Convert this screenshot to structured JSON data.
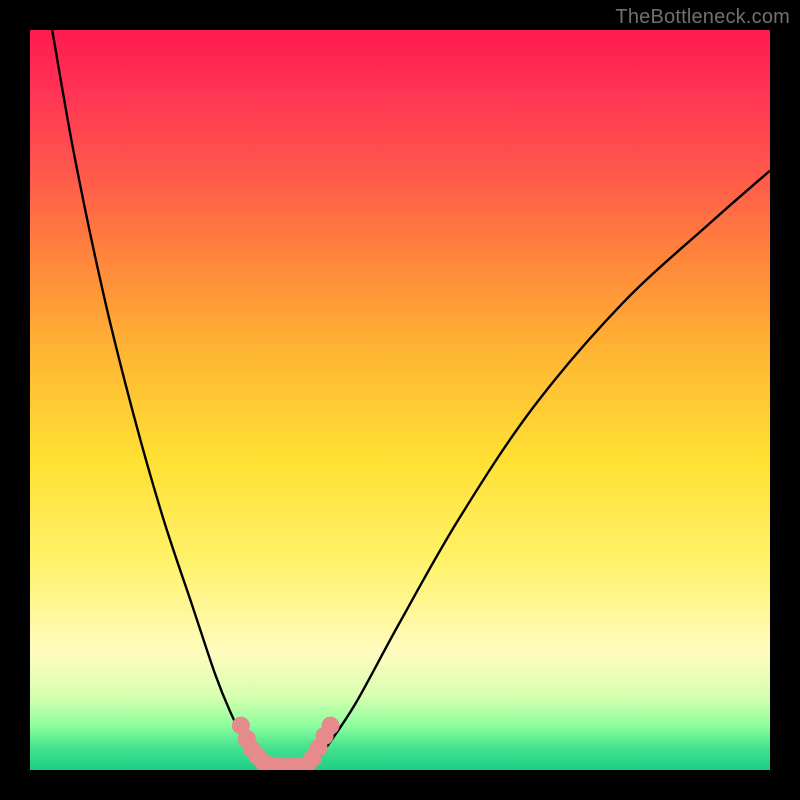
{
  "watermark": "TheBottleneck.com",
  "chart_data": {
    "type": "line",
    "title": "",
    "xlabel": "",
    "ylabel": "",
    "xlim": [
      0,
      100
    ],
    "ylim": [
      0,
      100
    ],
    "gradient_stops": [
      {
        "pct": 0,
        "color": "#ff1a4d"
      },
      {
        "pct": 8,
        "color": "#ff3355"
      },
      {
        "pct": 20,
        "color": "#ff5b4a"
      },
      {
        "pct": 32,
        "color": "#ff8a3a"
      },
      {
        "pct": 44,
        "color": "#ffb733"
      },
      {
        "pct": 58,
        "color": "#ffe033"
      },
      {
        "pct": 72,
        "color": "#fff26b"
      },
      {
        "pct": 84,
        "color": "#fffcbf"
      },
      {
        "pct": 90,
        "color": "#d8ffb0"
      },
      {
        "pct": 94,
        "color": "#8cff9e"
      },
      {
        "pct": 97,
        "color": "#44e28f"
      },
      {
        "pct": 100,
        "color": "#1ccf86"
      }
    ],
    "series": [
      {
        "name": "bottleneck-curve",
        "x": [
          3,
          6,
          10,
          14,
          18,
          22,
          25,
          27,
          29,
          30.5,
          32,
          34,
          36,
          38.5,
          40,
          44,
          50,
          58,
          68,
          80,
          92,
          100
        ],
        "y": [
          100,
          83,
          64,
          48,
          34,
          22,
          13,
          8,
          4,
          2,
          1,
          0.5,
          0.5,
          1,
          3,
          9,
          20,
          34,
          49,
          63,
          74,
          81
        ]
      }
    ],
    "markers": {
      "name": "highlight-region",
      "color": "#e58b8b",
      "points": [
        {
          "x": 28.5,
          "y": 6
        },
        {
          "x": 29.3,
          "y": 4.2
        },
        {
          "x": 30.0,
          "y": 2.8
        },
        {
          "x": 30.8,
          "y": 1.8
        },
        {
          "x": 31.6,
          "y": 1.0
        },
        {
          "x": 32.6,
          "y": 0.6
        },
        {
          "x": 33.8,
          "y": 0.5
        },
        {
          "x": 35.0,
          "y": 0.5
        },
        {
          "x": 36.2,
          "y": 0.5
        },
        {
          "x": 37.4,
          "y": 0.6
        },
        {
          "x": 38.2,
          "y": 1.6
        },
        {
          "x": 39.0,
          "y": 3.0
        },
        {
          "x": 39.8,
          "y": 4.6
        },
        {
          "x": 40.6,
          "y": 6.0
        }
      ]
    }
  }
}
